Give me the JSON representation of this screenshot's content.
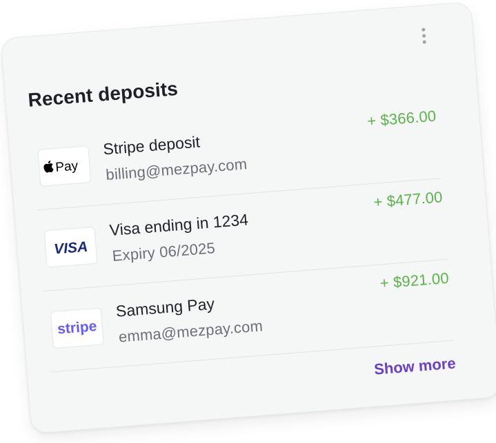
{
  "card": {
    "title": "Recent deposits",
    "menu_icon": "more-vertical-icon",
    "show_more_label": "Show more"
  },
  "deposits": [
    {
      "logo": "apple-pay-logo",
      "logo_text": "Pay",
      "name": "Stripe deposit",
      "sub": "billing@mezpay.com",
      "amount": "+ $366.00"
    },
    {
      "logo": "visa-logo",
      "logo_text": "VISA",
      "name": "Visa ending in 1234",
      "sub": "Expiry 06/2025",
      "amount": "+ $477.00"
    },
    {
      "logo": "stripe-logo",
      "logo_text": "stripe",
      "name": "Samsung Pay",
      "sub": "emma@mezpay.com",
      "amount": "+ $921.00"
    }
  ],
  "colors": {
    "amount": "#5ab44a",
    "link": "#6a40c8",
    "visa": "#1a2a7a",
    "stripe": "#635bff"
  }
}
